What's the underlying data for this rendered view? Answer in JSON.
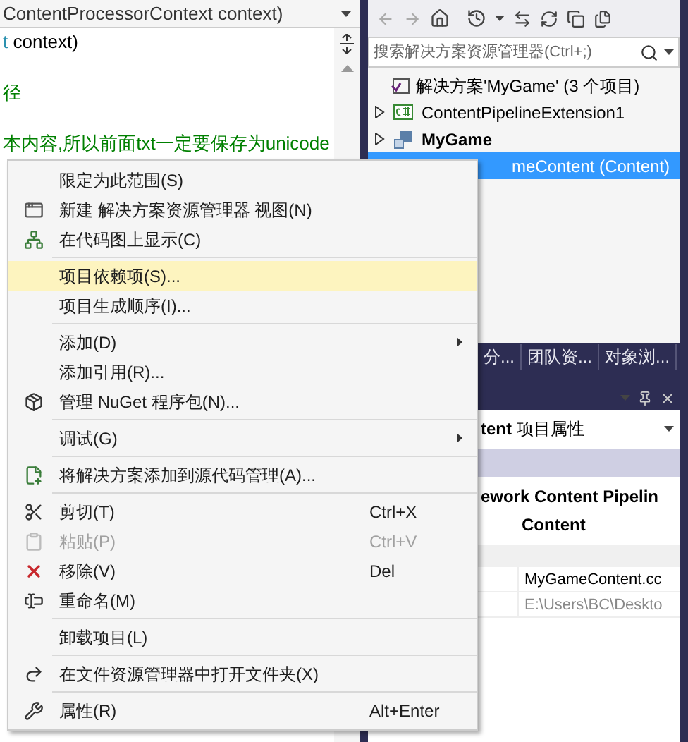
{
  "editor": {
    "member_dropdown": "ContentProcessorContext context)",
    "code_lines": [
      {
        "segments": [
          {
            "text": "t",
            "kind": "type"
          },
          {
            "text": " context)",
            "kind": "plain"
          }
        ]
      },
      {
        "segments": [
          {
            "text": "径",
            "kind": "comment"
          }
        ]
      },
      {
        "segments": [
          {
            "text": "本内容,所以前面txt一定要保存为unicode",
            "kind": "comment"
          }
        ]
      }
    ]
  },
  "solution_explorer": {
    "search": {
      "placeholder": "搜索解决方案资源管理器(Ctrl+;)"
    },
    "tree": [
      {
        "label": "解决方案'MyGame' (3 个项目)",
        "kind": "solution",
        "selected": false,
        "children": [
          {
            "label": "ContentPipelineExtension1",
            "kind": "csharp",
            "expanded": false,
            "startup": false,
            "selected": false
          },
          {
            "label": "MyGame",
            "kind": "game",
            "expanded": false,
            "startup": true,
            "selected": false
          },
          {
            "label": "meContent (Content)",
            "kind": "content",
            "startup": false,
            "selected": true
          }
        ]
      }
    ]
  },
  "tabs": [
    {
      "label": "分..."
    },
    {
      "label": "团队资..."
    },
    {
      "label": "对象浏..."
    }
  ],
  "properties": {
    "object_dropdown": "**tent** 项目属性",
    "title_lines": [
      "ework Content Pipelin",
      "Content"
    ],
    "rows": [
      {
        "value": "MyGameContent.cc",
        "readonly": false
      },
      {
        "value": "E:\\Users\\BC\\Deskto",
        "readonly": true
      }
    ]
  },
  "context_menu": {
    "groups": [
      [
        {
          "label": "限定为此范围(S)",
          "selected": false,
          "disabled": false,
          "submenu": false
        },
        {
          "label": "新建 解决方案资源管理器 视图(N)",
          "selected": false,
          "disabled": false,
          "submenu": false
        },
        {
          "label": "在代码图上显示(C)",
          "selected": false,
          "disabled": false,
          "submenu": false
        }
      ],
      [
        {
          "label": "项目依赖项(S)...",
          "selected": true,
          "disabled": false,
          "submenu": false
        },
        {
          "label": "项目生成顺序(I)...",
          "selected": false,
          "disabled": false,
          "submenu": false
        }
      ],
      [
        {
          "label": "添加(D)",
          "selected": false,
          "disabled": false,
          "submenu": true
        },
        {
          "label": "添加引用(R)...",
          "selected": false,
          "disabled": false,
          "submenu": false
        },
        {
          "label": "管理 NuGet 程序包(N)...",
          "selected": false,
          "disabled": false,
          "submenu": false
        }
      ],
      [
        {
          "label": "调试(G)",
          "selected": false,
          "disabled": false,
          "submenu": true
        }
      ],
      [
        {
          "label": "将解决方案添加到源代码管理(A)...",
          "selected": false,
          "disabled": false,
          "submenu": false
        }
      ],
      [
        {
          "label": "剪切(T)",
          "shortcut": "Ctrl+X",
          "selected": false,
          "disabled": false,
          "submenu": false
        },
        {
          "label": "粘贴(P)",
          "shortcut": "Ctrl+V",
          "selected": false,
          "disabled": true,
          "submenu": false
        },
        {
          "label": "移除(V)",
          "shortcut": "Del",
          "selected": false,
          "disabled": false,
          "submenu": false
        },
        {
          "label": "重命名(M)",
          "selected": false,
          "disabled": false,
          "submenu": false
        }
      ],
      [
        {
          "label": "卸载项目(L)",
          "selected": false,
          "disabled": false,
          "submenu": false
        }
      ],
      [
        {
          "label": "在文件资源管理器中打开文件夹(X)",
          "selected": false,
          "disabled": false,
          "submenu": false
        }
      ],
      [
        {
          "label": "属性(R)",
          "shortcut": "Alt+Enter",
          "selected": false,
          "disabled": false,
          "submenu": false
        }
      ]
    ]
  }
}
